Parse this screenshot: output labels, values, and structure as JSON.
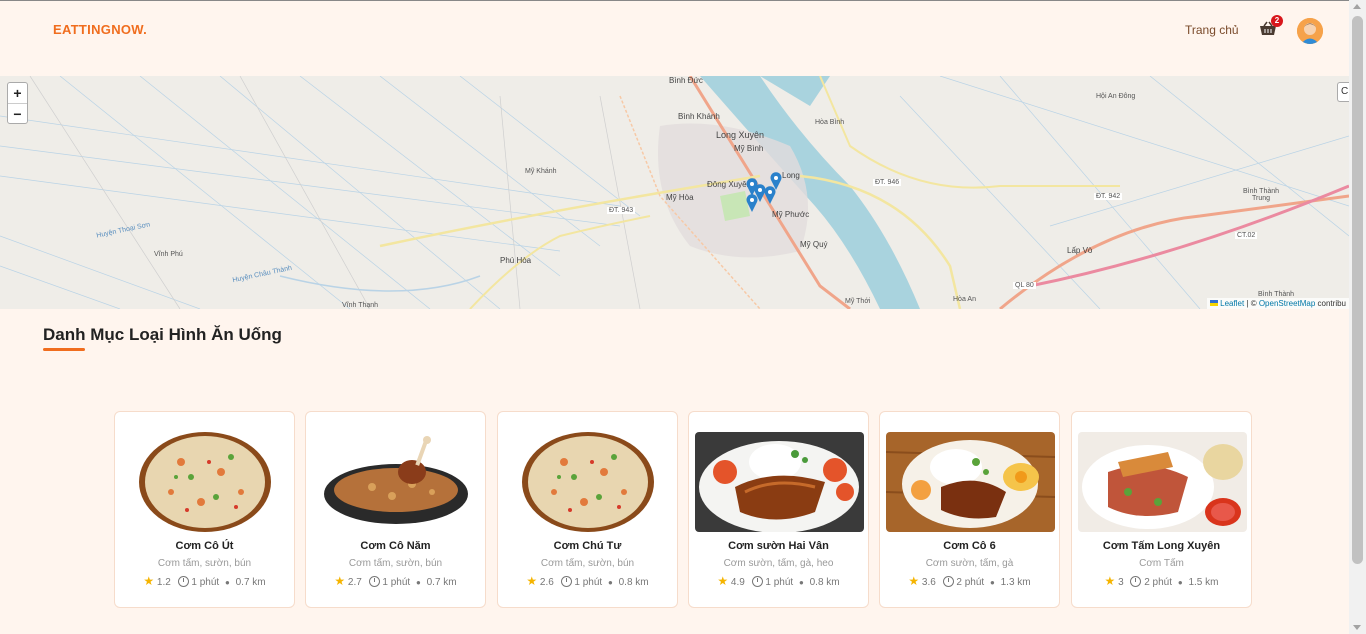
{
  "header": {
    "logo": "EATTINGNOW.",
    "nav_home": "Trang chủ",
    "cart_count": "2"
  },
  "map": {
    "zoom_in": "+",
    "zoom_out": "−",
    "right_control": "C",
    "attribution_leaflet": "Leaflet",
    "attribution_sep": " | © ",
    "attribution_osm": "OpenStreetMap",
    "attribution_rest": " contribu",
    "labels": {
      "binh_duc": "Bình Đức",
      "binh_khanh": "Bình Khánh",
      "long_xuyen": "Long Xuyên",
      "my_binh": "Mỹ Bình",
      "dong_xuyen": "Đông Xuyên",
      "long": "Long",
      "my_phuoc": "Mỹ Phước",
      "my_quy": "Mỹ Quý",
      "my_hoa": "Mỹ Hòa",
      "my_khanh": "Mỹ Khánh",
      "phu_hoa": "Phú Hòa",
      "vinh_phu": "Vĩnh Phú",
      "vinh_thanh": "Vĩnh Thạnh",
      "hoa_binh": "Hòa Bình",
      "hoi_an_dong": "Hội An Đông",
      "binh_thanh_trung": "Bình Thành Trung",
      "lap_vo": "Lấp Vò",
      "hoa_an": "Hòa An",
      "my_thoi": "Mỹ Thới",
      "binh_thanh": "Bình Thành",
      "dt943": "ĐT. 943",
      "dt946": "ĐT. 946",
      "dt942": "ĐT. 942",
      "ct02": "CT.02",
      "ql80": "QL 80",
      "huyen_thoai_son": "Huyện Thoại Sơn",
      "huyen_chau_thanh": "Huyện Châu Thành"
    }
  },
  "section": {
    "title": "Danh Mục Loại Hình Ăn Uống"
  },
  "colors": {
    "accent": "#f06d1e",
    "background": "#fff5ee",
    "badge": "#d8161b",
    "star": "#f5b400"
  },
  "restaurants": [
    {
      "name": "Cơm Cô Út",
      "desc": "Cơm tấm, sườn, bún",
      "rating": "1.2",
      "time": "1 phút",
      "distance": "0.7 km",
      "image": "fried-rice-plate"
    },
    {
      "name": "Cơm Cô Năm",
      "desc": "Cơm tấm, sườn, bún",
      "rating": "2.7",
      "time": "1 phút",
      "distance": "0.7 km",
      "image": "biryani-chicken-plate"
    },
    {
      "name": "Cơm Chú Tư",
      "desc": "Cơm tấm, sườn, bún",
      "rating": "2.6",
      "time": "1 phút",
      "distance": "0.8 km",
      "image": "fried-rice-plate"
    },
    {
      "name": "Cơm sườn Hai Vân",
      "desc": "Cơm sườn, tấm, gà, heo",
      "rating": "4.9",
      "time": "1 phút",
      "distance": "0.8 km",
      "image": "grilled-pork-rice"
    },
    {
      "name": "Cơm Cô 6",
      "desc": "Cơm sườn, tấm, gà",
      "rating": "3.6",
      "time": "2 phút",
      "distance": "1.3 km",
      "image": "broken-rice-egg"
    },
    {
      "name": "Cơm Tấm Long Xuyên",
      "desc": "Cơm Tấm",
      "rating": "3",
      "time": "2 phút",
      "distance": "1.5 km",
      "image": "com-tam-platter"
    }
  ]
}
